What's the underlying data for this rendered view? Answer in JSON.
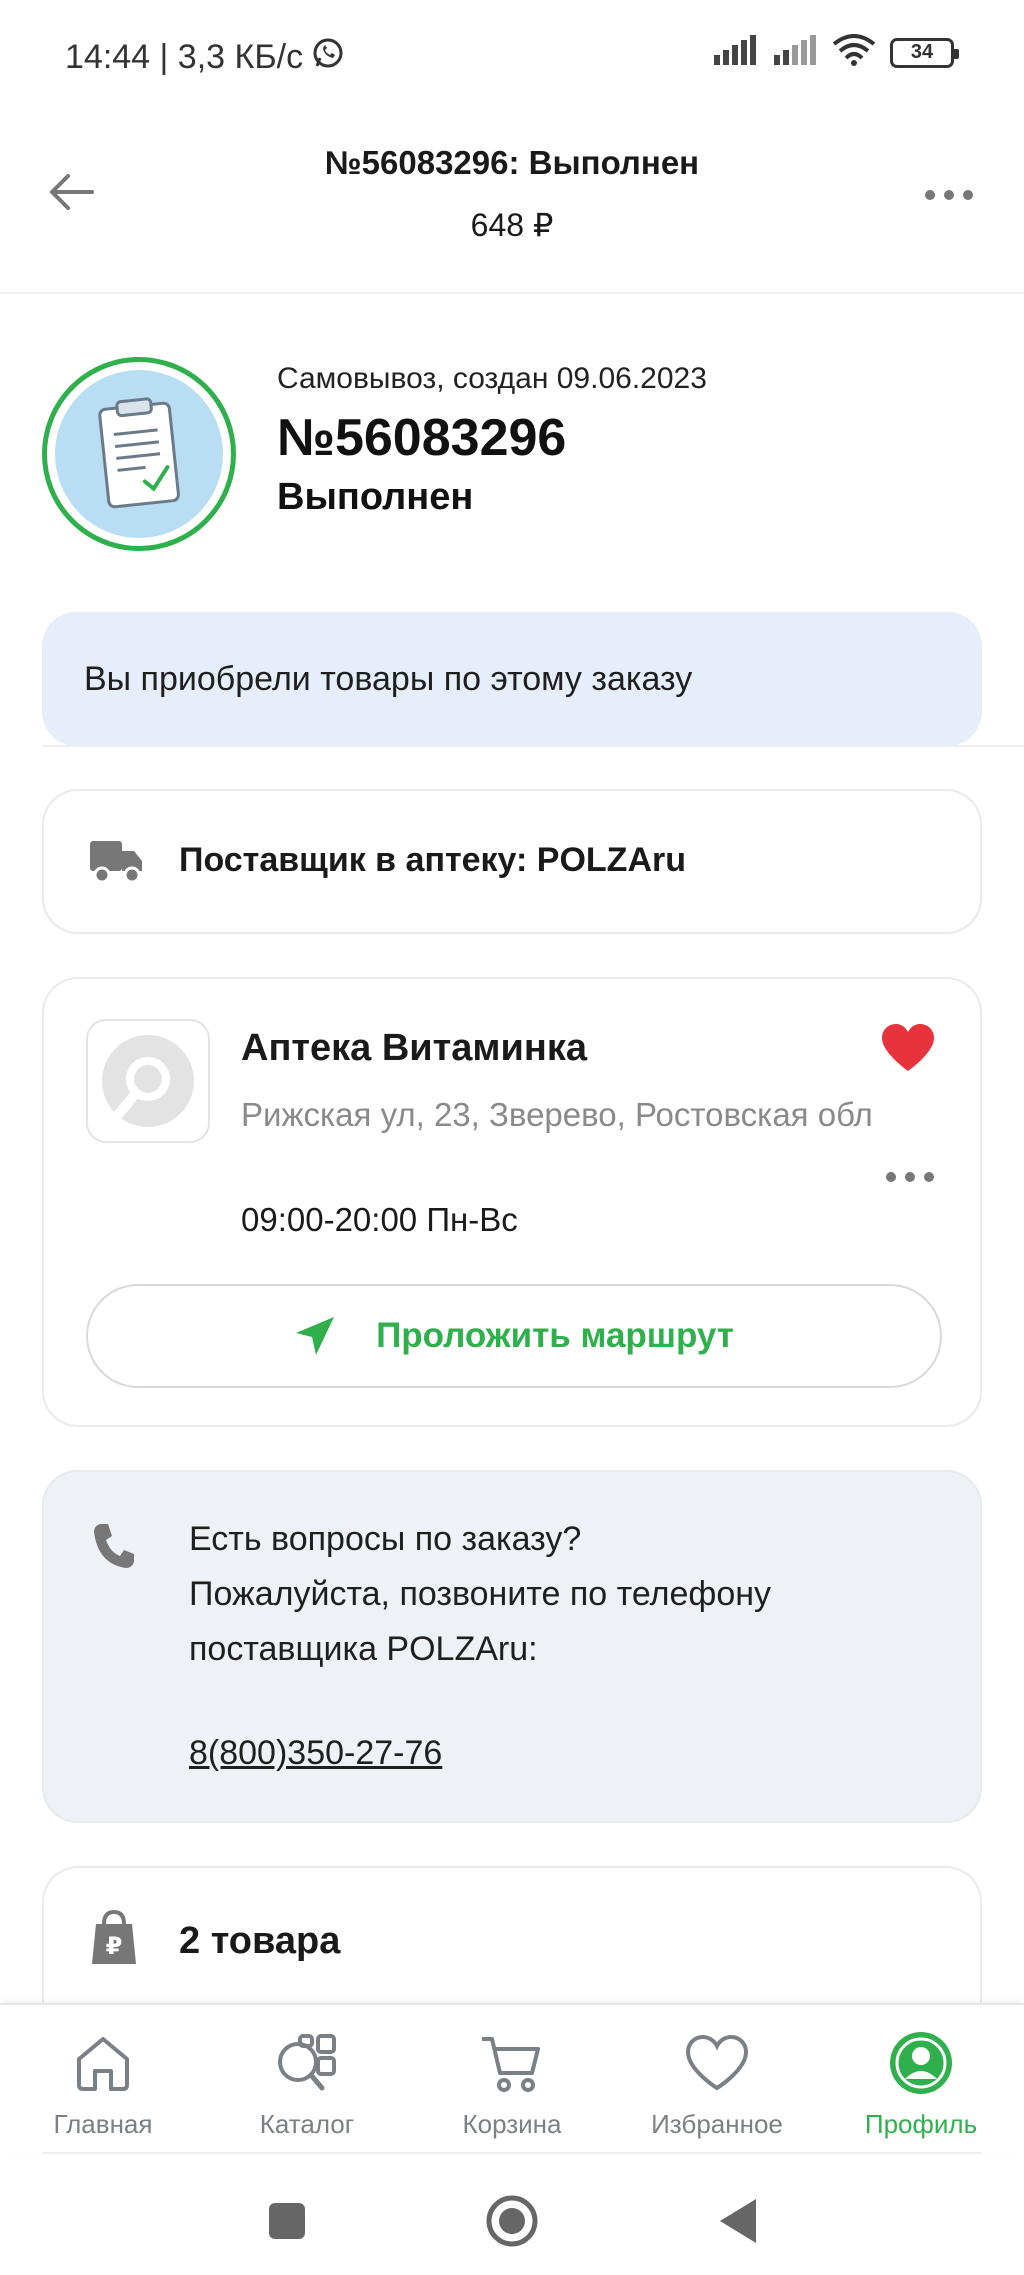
{
  "status_bar": {
    "time_speed": "14:44 | 3,3 КБ/с",
    "battery": "34"
  },
  "header": {
    "title": "№56083296: Выполнен",
    "sum": "648 ₽"
  },
  "order": {
    "subtitle": "Самовывоз, создан 09.06.2023",
    "number": "№56083296",
    "status": "Выполнен"
  },
  "banner": {
    "text": "Вы приобрели товары по этому заказу"
  },
  "supplier": {
    "text": "Поставщик в аптеку: POLZAru"
  },
  "pharmacy": {
    "name": "Аптека Витаминка",
    "address": "Рижская ул, 23, Зверево, Ростовская обл",
    "hours": "09:00-20:00 Пн-Вс",
    "route_label": "Проложить маршрут"
  },
  "questions": {
    "line1": "Есть вопросы по заказу?",
    "line2": "Пожалуйста, позвоните по телефону поставщика POLZAru:",
    "phone": "8(800)350-27-76"
  },
  "items": {
    "count_label": "2 товара"
  },
  "bottom_nav": {
    "items": [
      {
        "label": "Главная"
      },
      {
        "label": "Каталог"
      },
      {
        "label": "Корзина"
      },
      {
        "label": "Избранное"
      },
      {
        "label": "Профиль"
      }
    ]
  },
  "colors": {
    "accent": "#2fb04c",
    "banner_bg": "#e6eefb",
    "heart": "#e8323c"
  }
}
